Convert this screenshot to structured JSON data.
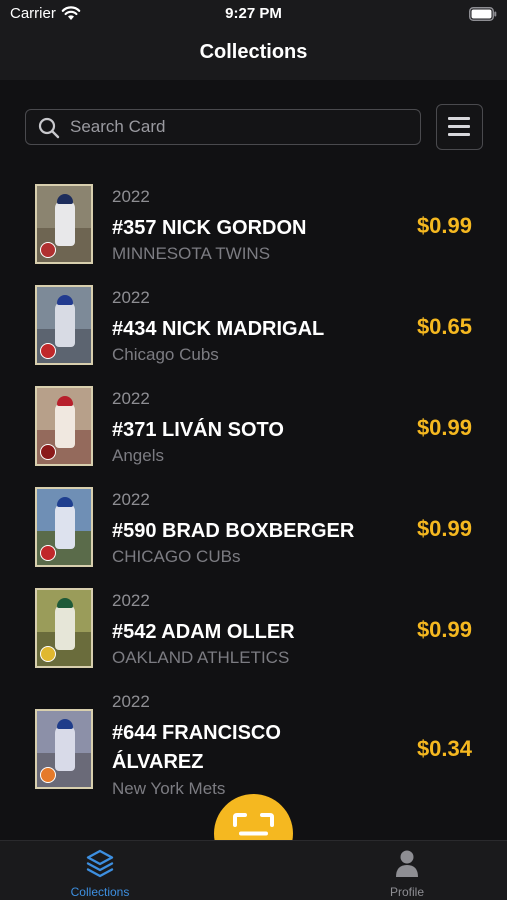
{
  "status_bar": {
    "carrier": "Carrier",
    "time": "9:27 PM"
  },
  "nav": {
    "title": "Collections"
  },
  "search": {
    "placeholder": "Search Card"
  },
  "cards": [
    {
      "year": "2022",
      "name": "#357 NICK GORDON",
      "team": "MINNESOTA TWINS",
      "price": "$0.99"
    },
    {
      "year": "2022",
      "name": "#434 NICK MADRIGAL",
      "team": "Chicago Cubs",
      "price": "$0.65"
    },
    {
      "year": "2022",
      "name": "#371 LIVÁN SOTO",
      "team": "Angels",
      "price": "$0.99"
    },
    {
      "year": "2022",
      "name": "#590 BRAD BOXBERGER",
      "team": "CHICAGO CUBs",
      "price": "$0.99"
    },
    {
      "year": "2022",
      "name": "#542 ADAM OLLER",
      "team": "OAKLAND ATHLETICS",
      "price": "$0.99"
    },
    {
      "year": "2022",
      "name": "#644 FRANCISCO ÁLVAREZ",
      "team": "New York Mets",
      "price": "$0.34"
    }
  ],
  "tabs": {
    "collections": {
      "label": "Collections",
      "icon": "stack-layers-icon",
      "active": true
    },
    "profile": {
      "label": "Profile",
      "icon": "person-icon",
      "active": false
    }
  },
  "scan_button": {
    "icon": "scan-frame-icon"
  },
  "colors": {
    "accent": "#f5b820",
    "active_tab": "#3d8fe0",
    "inactive_tab": "#8e8e93",
    "background": "#111113"
  }
}
